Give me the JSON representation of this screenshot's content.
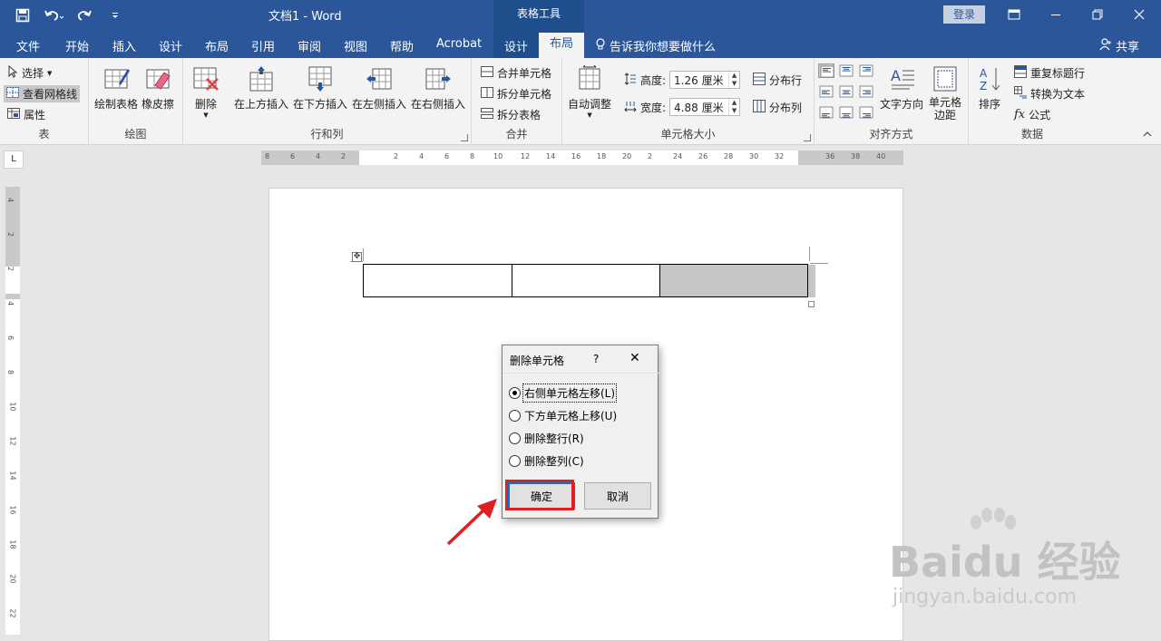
{
  "titlebar": {
    "doc_title": "文档1  -  Word",
    "context_tools": "表格工具",
    "login": "登录"
  },
  "tabs": [
    "文件",
    "开始",
    "插入",
    "设计",
    "布局",
    "引用",
    "审阅",
    "视图",
    "帮助",
    "Acrobat",
    "设计",
    "布局"
  ],
  "active_tab": "布局",
  "tell_me": "告诉我你想要做什么",
  "share": "共享",
  "ribbon": {
    "table_group": {
      "label": "表",
      "select": "选择",
      "view_gridlines": "查看网格线",
      "properties": "属性"
    },
    "draw_group": {
      "label": "绘图",
      "draw_table": "绘制表格",
      "eraser": "橡皮擦"
    },
    "rows_cols_group": {
      "label": "行和列",
      "delete": "删除",
      "insert_above": "在上方插入",
      "insert_below": "在下方插入",
      "insert_left": "在左侧插入",
      "insert_right": "在右侧插入"
    },
    "merge_group": {
      "label": "合并",
      "merge_cells": "合并单元格",
      "split_cells": "拆分单元格",
      "split_table": "拆分表格"
    },
    "cell_size_group": {
      "label": "单元格大小",
      "autofit": "自动调整",
      "height_label": "高度:",
      "height_value": "1.26 厘米",
      "width_label": "宽度:",
      "width_value": "4.88 厘米",
      "distribute_rows": "分布行",
      "distribute_cols": "分布列"
    },
    "align_group": {
      "label": "对齐方式",
      "text_direction": "文字方向",
      "cell_margins": "单元格边距"
    },
    "data_group": {
      "label": "数据",
      "sort": "排序",
      "repeat_header": "重复标题行",
      "convert_to_text": "转换为文本",
      "formula": "公式"
    }
  },
  "ruler": {
    "corner": "L",
    "ticks": [
      "8",
      "6",
      "4",
      "2",
      "2",
      "4",
      "6",
      "8",
      "10",
      "12",
      "14",
      "16",
      "18",
      "20",
      "2",
      "24",
      "26",
      "28",
      "30",
      "32",
      "36",
      "38",
      "40"
    ],
    "vticks": [
      "4",
      "2",
      "2",
      "4",
      "6",
      "8",
      "10",
      "12",
      "14",
      "16",
      "18",
      "20",
      "22"
    ]
  },
  "dialog": {
    "title": "删除单元格",
    "help": "?",
    "close": "✕",
    "options": [
      {
        "label": "右侧单元格左移(L)",
        "selected": true
      },
      {
        "label": "下方单元格上移(U)",
        "selected": false
      },
      {
        "label": "删除整行(R)",
        "selected": false
      },
      {
        "label": "删除整列(C)",
        "selected": false
      }
    ],
    "ok": "确定",
    "cancel": "取消"
  },
  "watermark": {
    "main": "Baidu 经验",
    "sub": "jingyan.baidu.com"
  },
  "colors": {
    "brand": "#2b579a",
    "highlight_red": "#e02020",
    "selected_cell": "#c6c6c6"
  }
}
